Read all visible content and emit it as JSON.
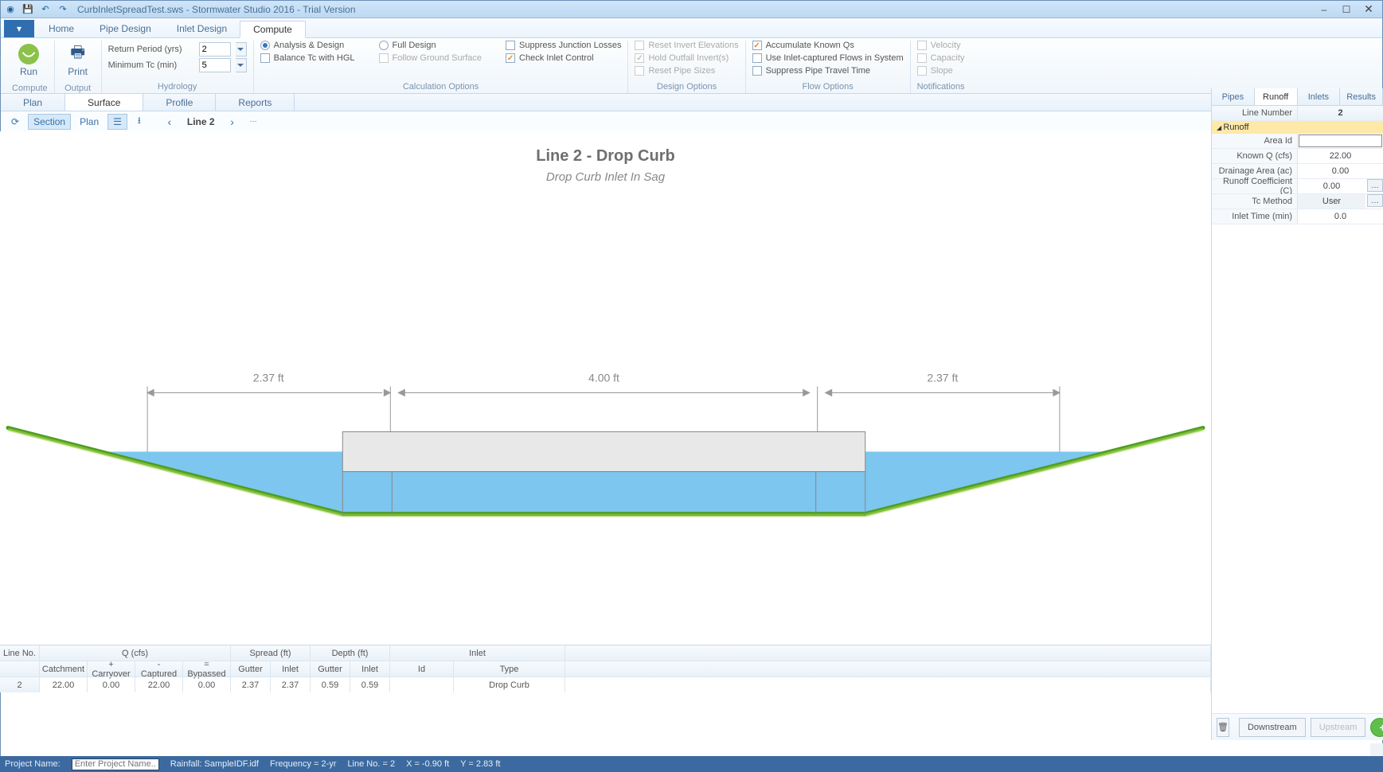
{
  "title": "CurbInletSpreadTest.sws - Stormwater Studio 2016 - Trial Version",
  "ribbon_tabs": {
    "file": "",
    "home": "Home",
    "pipe": "Pipe Design",
    "inlet": "Inlet Design",
    "compute": "Compute"
  },
  "ribbon": {
    "compute": {
      "run": "Run",
      "print": "Print",
      "group_compute": "Compute",
      "group_output": "Output"
    },
    "hydrology": {
      "return_label": "Return Period (yrs)",
      "return_val": "2",
      "mintc_label": "Minimum Tc (min)",
      "mintc_val": "5",
      "group": "Hydrology"
    },
    "calcopt": {
      "analysis": "Analysis & Design",
      "full": "Full Design",
      "balance": "Balance Tc with HGL",
      "follow": "Follow Ground Surface",
      "suppress_jl": "Suppress Junction Losses",
      "check_ic": "Check Inlet Control",
      "group": "Calculation Options"
    },
    "designopt": {
      "reset_ie": "Reset Invert Elevations",
      "hold_oi": "Hold Outfall Invert(s)",
      "reset_ps": "Reset Pipe Sizes",
      "group": "Design Options"
    },
    "flowopt": {
      "accum": "Accumulate Known Qs",
      "inletcap": "Use Inlet-captured Flows in System",
      "suppress_pt": "Suppress Pipe Travel Time",
      "group": "Flow Options"
    },
    "notif": {
      "vel": "Velocity",
      "cap": "Capacity",
      "slope": "Slope",
      "group": "Notifications"
    }
  },
  "view_tabs": {
    "plan": "Plan",
    "surface": "Surface",
    "profile": "Profile",
    "reports": "Reports"
  },
  "toolstrip": {
    "section": "Section",
    "plan": "Plan",
    "line": "Line 2"
  },
  "chart": {
    "title": "Line 2 - Drop Curb",
    "subtitle": "Drop Curb Inlet In Sag",
    "dim_left": "2.37 ft",
    "dim_mid": "4.00 ft",
    "dim_right": "2.37 ft"
  },
  "chart_data": {
    "type": "area",
    "title": "Line 2 - Drop Curb",
    "subtitle": "Drop Curb Inlet In Sag",
    "dimensions_ft": [
      2.37,
      4.0,
      2.37
    ],
    "ground": [
      {
        "x": -15,
        "y": 0.5
      },
      {
        "x": -4.37,
        "y": 0
      },
      {
        "x": 4.37,
        "y": 0
      },
      {
        "x": 15,
        "y": 0.5
      }
    ],
    "inlet_box": {
      "x0": -4.0,
      "x1": 4.0,
      "y_top": 1.2,
      "y_water": 0.59
    },
    "water_depth_ft": 0.59
  },
  "grid": {
    "h1": {
      "lineno": "Line No.",
      "q": "Q (cfs)",
      "spread": "Spread (ft)",
      "depth": "Depth (ft)",
      "inlet": "Inlet"
    },
    "h2": {
      "catch": "Catchment",
      "carry": "+ Carryover",
      "cap": "- Captured",
      "byp": "= Bypassed",
      "sg": "Gutter",
      "si": "Inlet",
      "dg": "Gutter",
      "di": "Inlet",
      "iid": "Id",
      "itype": "Type"
    },
    "row": {
      "lineno": "2",
      "catch": "22.00",
      "carry": "0.00",
      "cap": "22.00",
      "byp": "0.00",
      "sg": "2.37",
      "si": "2.37",
      "dg": "0.59",
      "di": "0.59",
      "iid": "",
      "itype": "Drop Curb"
    }
  },
  "right": {
    "tabs": {
      "pipes": "Pipes",
      "runoff": "Runoff",
      "inlets": "Inlets",
      "results": "Results"
    },
    "line_label": "Line Number",
    "line_val": "2",
    "group_runoff": "Runoff",
    "area_id_label": "Area Id",
    "area_id_val": "",
    "knownq_label": "Known Q (cfs)",
    "knownq_val": "22.00",
    "da_label": "Drainage Area (ac)",
    "da_val": "0.00",
    "rc_label": "Runoff Coefficient (C)",
    "rc_val": "0.00",
    "tcm_label": "Tc Method",
    "tcm_val": "User",
    "it_label": "Inlet Time (min)",
    "it_val": "0.0",
    "downstream": "Downstream",
    "upstream": "Upstream"
  },
  "status": {
    "pn_label": "Project Name:",
    "pn_ph": "Enter Project Name...",
    "rain": "Rainfall: SampleIDF.idf",
    "freq": "Frequency = 2-yr",
    "line": "Line No. = 2",
    "x": "X = -0.90 ft",
    "y": "Y = 2.83 ft"
  }
}
